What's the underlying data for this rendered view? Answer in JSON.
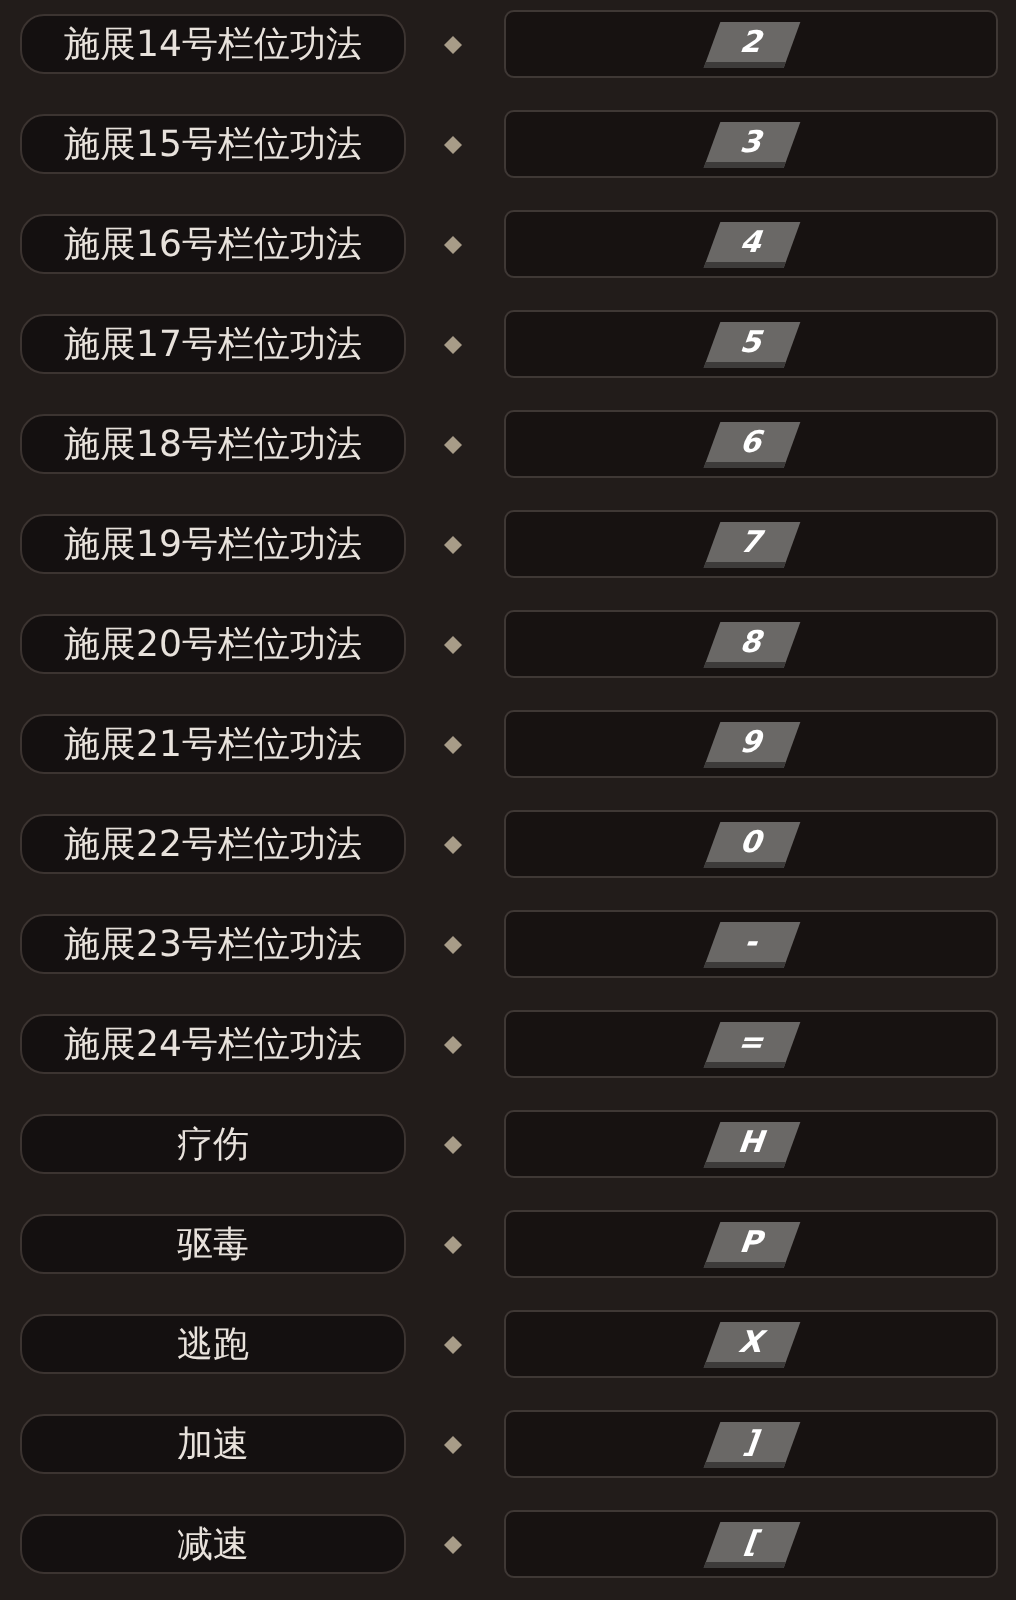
{
  "bindings": [
    {
      "action": "施展14号栏位功法",
      "key": "2"
    },
    {
      "action": "施展15号栏位功法",
      "key": "3"
    },
    {
      "action": "施展16号栏位功法",
      "key": "4"
    },
    {
      "action": "施展17号栏位功法",
      "key": "5"
    },
    {
      "action": "施展18号栏位功法",
      "key": "6"
    },
    {
      "action": "施展19号栏位功法",
      "key": "7"
    },
    {
      "action": "施展20号栏位功法",
      "key": "8"
    },
    {
      "action": "施展21号栏位功法",
      "key": "9"
    },
    {
      "action": "施展22号栏位功法",
      "key": "0"
    },
    {
      "action": "施展23号栏位功法",
      "key": "-"
    },
    {
      "action": "施展24号栏位功法",
      "key": "="
    },
    {
      "action": "疗伤",
      "key": "H"
    },
    {
      "action": "驱毒",
      "key": "P"
    },
    {
      "action": "逃跑",
      "key": "X"
    },
    {
      "action": "加速",
      "key": "]"
    },
    {
      "action": "减速",
      "key": "["
    }
  ]
}
